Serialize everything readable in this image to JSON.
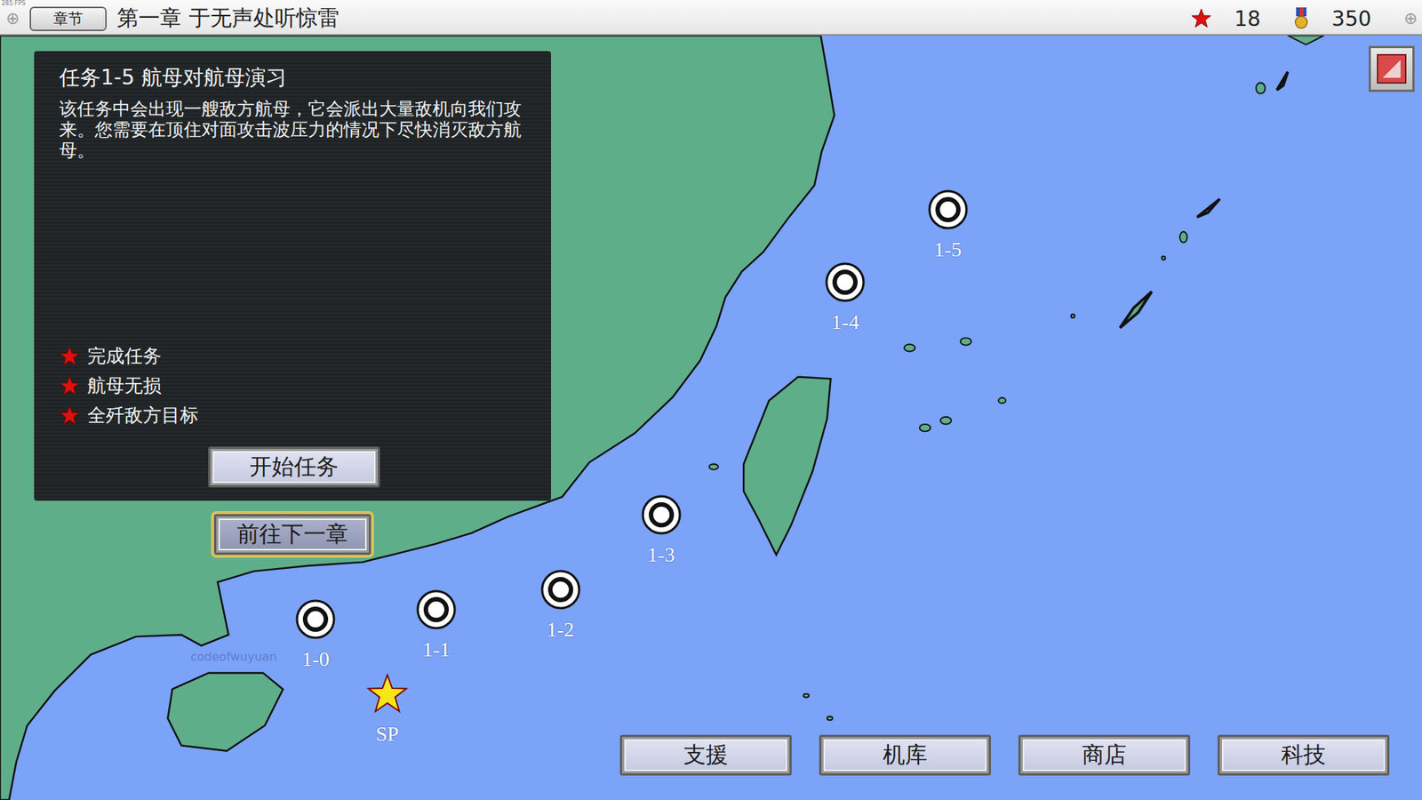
{
  "fps": "285 FPS",
  "topbar": {
    "left_icon": "⊕",
    "chapter_button": "章节",
    "title": "第一章 于无声处听惊雷",
    "stars": "18",
    "medals": "350",
    "right_icon": "⊕"
  },
  "mission": {
    "title": "任务1-5 航母对航母演习",
    "description": "该任务中会出现一艘敌方航母，它会派出大量敌机向我们攻来。您需要在顶住对面攻击波压力的情况下尽快消灭敌方航母。",
    "objectives": [
      {
        "label": "完成任务",
        "achieved": true
      },
      {
        "label": "航母无损",
        "achieved": true
      },
      {
        "label": "全歼敌方目标",
        "achieved": true
      }
    ],
    "start_button": "开始任务"
  },
  "next_chapter": {
    "label": "前往下一章",
    "highlighted": true
  },
  "nodes": [
    {
      "label": "1-0",
      "kind": "ring"
    },
    {
      "label": "1-1",
      "kind": "ring"
    },
    {
      "label": "1-2",
      "kind": "ring"
    },
    {
      "label": "1-3",
      "kind": "ring"
    },
    {
      "label": "1-4",
      "kind": "ring"
    },
    {
      "label": "1-5",
      "kind": "ring"
    },
    {
      "label": "SP",
      "kind": "star"
    }
  ],
  "watermark": "codeofwuyuan",
  "bottom_buttons": [
    "支援",
    "机库",
    "商店",
    "科技"
  ]
}
